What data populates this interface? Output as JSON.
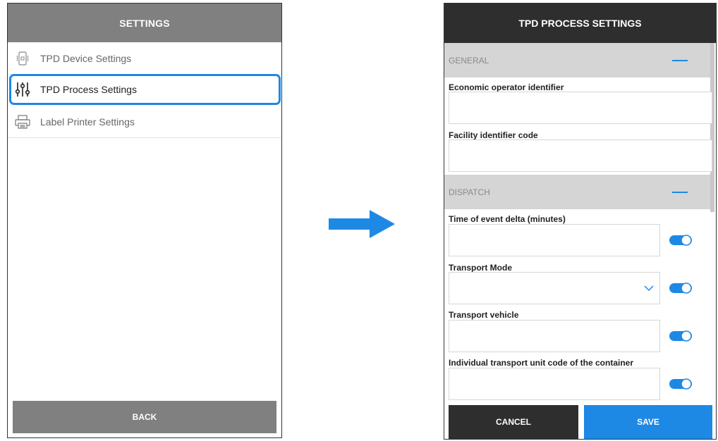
{
  "settings_screen": {
    "title": "SETTINGS",
    "items": [
      {
        "label": "TPD Device Settings",
        "icon": "device-icon"
      },
      {
        "label": "TPD Process Settings",
        "icon": "sliders-icon",
        "selected": true
      },
      {
        "label": "Label Printer Settings",
        "icon": "printer-icon"
      }
    ],
    "back_label": "BACK"
  },
  "process_screen": {
    "title": "TPD PROCESS SETTINGS",
    "sections": [
      {
        "name": "GENERAL",
        "fields": [
          {
            "label": "Economic operator identifier",
            "value": ""
          },
          {
            "label": "Facility identifier code",
            "value": ""
          }
        ]
      },
      {
        "name": "DISPATCH",
        "fields": [
          {
            "label": "Time of event delta (minutes)",
            "value": "",
            "toggle_on": true
          },
          {
            "label": "Transport Mode",
            "value": "",
            "type": "select",
            "toggle_on": true
          },
          {
            "label": "Transport vehicle",
            "value": "",
            "toggle_on": true
          },
          {
            "label": "Individual transport unit code of the container",
            "value": "",
            "toggle_on": true
          }
        ]
      }
    ],
    "cancel_label": "CANCEL",
    "save_label": "SAVE"
  },
  "colors": {
    "accent": "#1e88e5",
    "header_gray": "#808080",
    "header_dark": "#2e2e2e",
    "section_gray": "#d5d5d5"
  }
}
